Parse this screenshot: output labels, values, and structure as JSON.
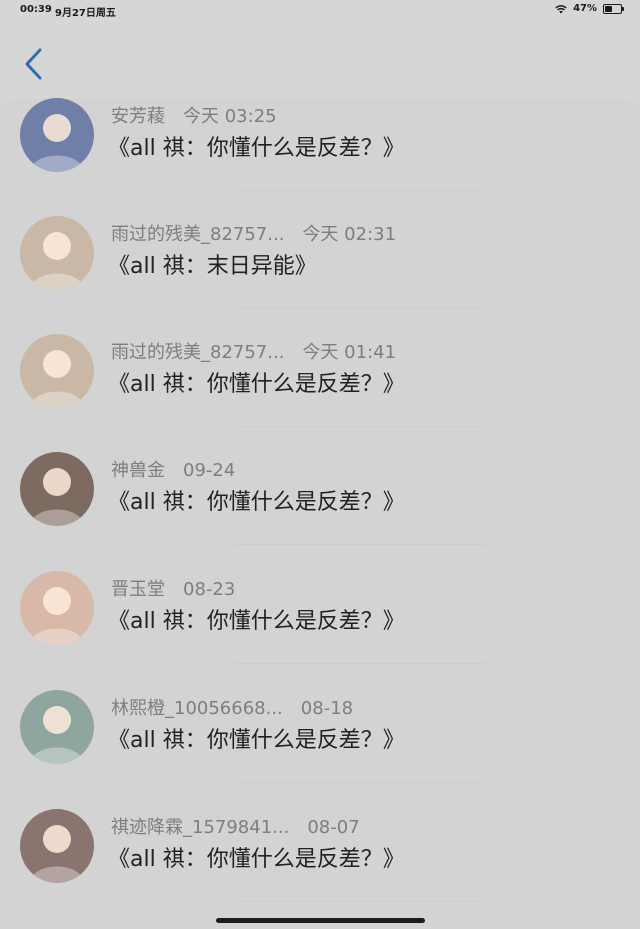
{
  "status_bar": {
    "time": "00:39",
    "date": "9月27日周五",
    "battery": "47%",
    "battery_level": 0.47
  },
  "nav": {
    "back_icon": "chevron-left-icon",
    "accent": "#2f6db0"
  },
  "comments": [
    {
      "name": "安芳薐",
      "time": "今天 03:25",
      "message": "《all 祺：你懂什么是反差？》",
      "avatar_color": "#6f7fa8"
    },
    {
      "name": "雨过的残美_82757...",
      "time": "今天 02:31",
      "message": "《all 祺：末日异能》",
      "avatar_color": "#c9b8a6"
    },
    {
      "name": "雨过的残美_82757...",
      "time": "今天 01:41",
      "message": "《all 祺：你懂什么是反差？》",
      "avatar_color": "#c9b8a6"
    },
    {
      "name": "神兽金",
      "time": "09-24",
      "message": "《all 祺：你懂什么是反差？》",
      "avatar_color": "#7d6a60"
    },
    {
      "name": "晋玉堂",
      "time": "08-23",
      "message": "《all 祺：你懂什么是反差？》",
      "avatar_color": "#d8b8a8"
    },
    {
      "name": "林熙橙_10056668...",
      "time": "08-18",
      "message": "《all 祺：你懂什么是反差？》",
      "avatar_color": "#8fa6a0"
    },
    {
      "name": "祺迹降霖_1579841...",
      "time": "08-07",
      "message": "《all 祺：你懂什么是反差？》",
      "avatar_color": "#8a7470"
    }
  ]
}
